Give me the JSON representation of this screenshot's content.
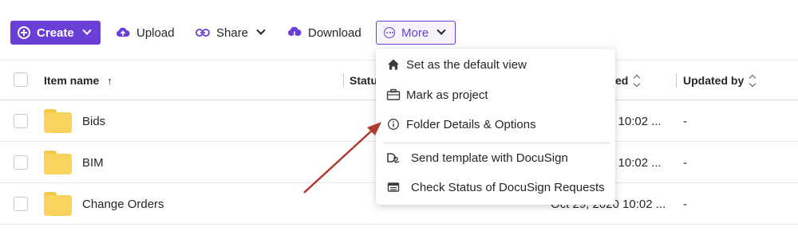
{
  "toolbar": {
    "create_label": "Create",
    "upload_label": "Upload",
    "share_label": "Share",
    "download_label": "Download",
    "more_label": "More"
  },
  "table": {
    "columns": {
      "item_name": "Item name",
      "status": "Statu",
      "updated": "ed",
      "updated_by": "Updated by"
    },
    "rows": [
      {
        "name": "Bids",
        "date": "0 10:02 ...",
        "by": "-"
      },
      {
        "name": "BIM",
        "date": "0 10:02 ...",
        "by": "-"
      },
      {
        "name": "Change Orders",
        "date": "Oct 29, 2020 10:02 ...",
        "by": "-"
      }
    ]
  },
  "menu": {
    "items": [
      {
        "label": "Set as the default view",
        "icon": "home-icon"
      },
      {
        "label": "Mark as project",
        "icon": "briefcase-icon"
      },
      {
        "label": "Folder Details & Options",
        "icon": "info-icon"
      },
      {
        "label": "Send template with DocuSign",
        "icon": "docusign-icon"
      },
      {
        "label": "Check Status of DocuSign Requests",
        "icon": "status-list-icon"
      }
    ]
  },
  "colors": {
    "accent": "#6a3fd6",
    "folder": "#f8d35e",
    "annotation_arrow": "#b03a2e"
  }
}
